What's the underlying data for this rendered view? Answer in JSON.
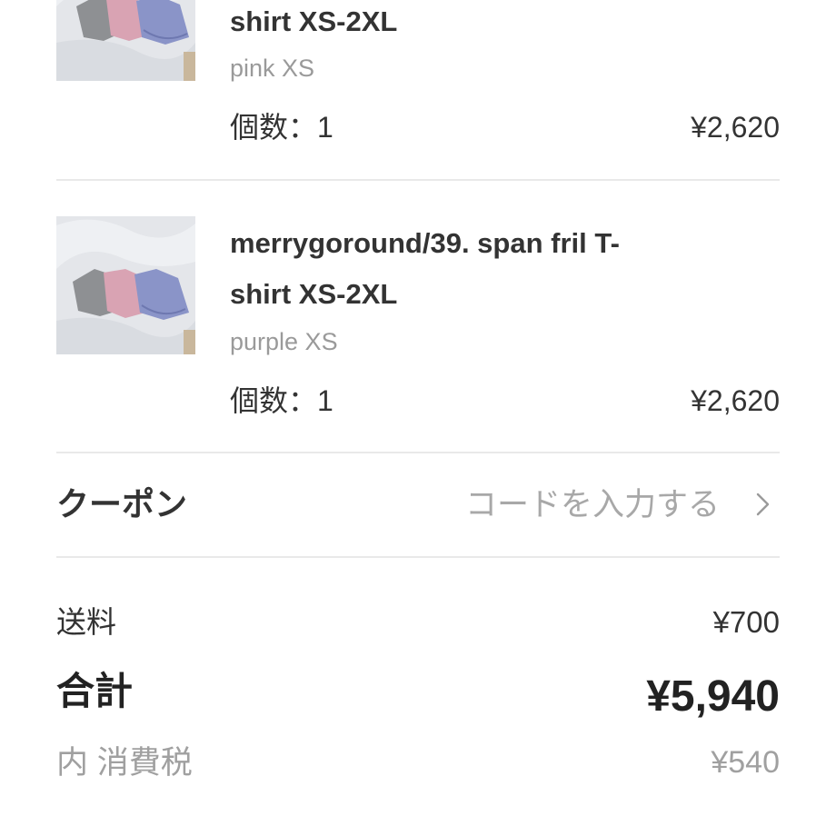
{
  "cart": {
    "items": [
      {
        "title_line1": "",
        "title_line2": "shirt XS-2XL",
        "variant": "pink XS",
        "qty_label": "個数：1",
        "price": "¥2,620"
      },
      {
        "title_line1": "merrygoround/39. span fril T-",
        "title_line2": "shirt XS-2XL",
        "variant": "purple XS",
        "qty_label": "個数：1",
        "price": "¥2,620"
      }
    ]
  },
  "coupon": {
    "label": "クーポン",
    "input_text": "コードを入力する",
    "icon": "chevron-right-icon"
  },
  "summary": {
    "shipping_label": "送料",
    "shipping_value": "¥700",
    "total_label": "合計",
    "total_value": "¥5,940",
    "tax_label": "内 消費税",
    "tax_value": "¥540"
  },
  "colors": {
    "text": "#333333",
    "muted": "#9a9a9a",
    "divider": "#e9e9e9",
    "background": "#ffffff"
  }
}
